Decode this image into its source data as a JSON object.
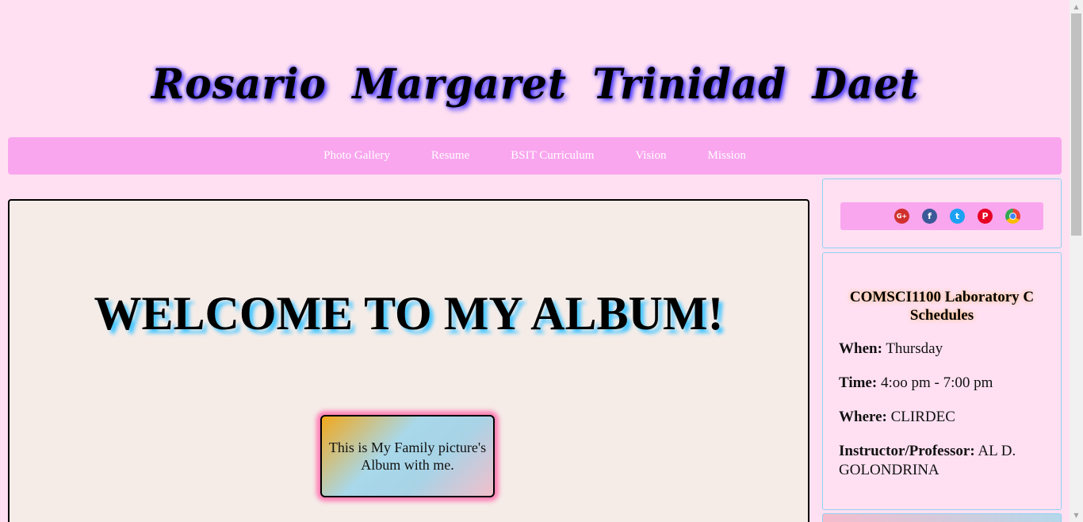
{
  "header": {
    "title": "Rosario  Margaret  Trinidad  Daet"
  },
  "nav": {
    "items": [
      {
        "label": "Photo Gallery"
      },
      {
        "label": "Resume"
      },
      {
        "label": "BSIT Curriculum"
      },
      {
        "label": "Vision"
      },
      {
        "label": "Mission"
      }
    ]
  },
  "main": {
    "heading": "WELCOME TO MY ALBUM!",
    "album_caption": "This is My Family picture's Album with me."
  },
  "social": {
    "icons": [
      {
        "name": "google-plus-icon",
        "glyph": "G+",
        "color": "#d0312d"
      },
      {
        "name": "facebook-icon",
        "glyph": "f",
        "color": "#3b5998"
      },
      {
        "name": "twitter-icon",
        "glyph": "t",
        "color": "#1da1f2"
      },
      {
        "name": "pinterest-icon",
        "glyph": "P",
        "color": "#e60023"
      },
      {
        "name": "chrome-icon",
        "glyph": "",
        "color": "#4285f4"
      }
    ]
  },
  "schedule": {
    "title": "COMSCI1100 Laboratory C Schedules",
    "when_label": "When:",
    "when_value": " Thursday",
    "time_label": "Time:",
    "time_value": " 4:oo pm - 7:00 pm",
    "where_label": "Where:",
    "where_value": " CLIRDEC",
    "instructor_label": "Instructor/Professor:",
    "instructor_value": " AL D. GOLONDRINA"
  },
  "colors": {
    "page_background": "#ffe0f2",
    "nav_background": "#f9a6ee",
    "main_panel_background": "#f5ece8",
    "sidebar_border": "#8fd2f0"
  }
}
